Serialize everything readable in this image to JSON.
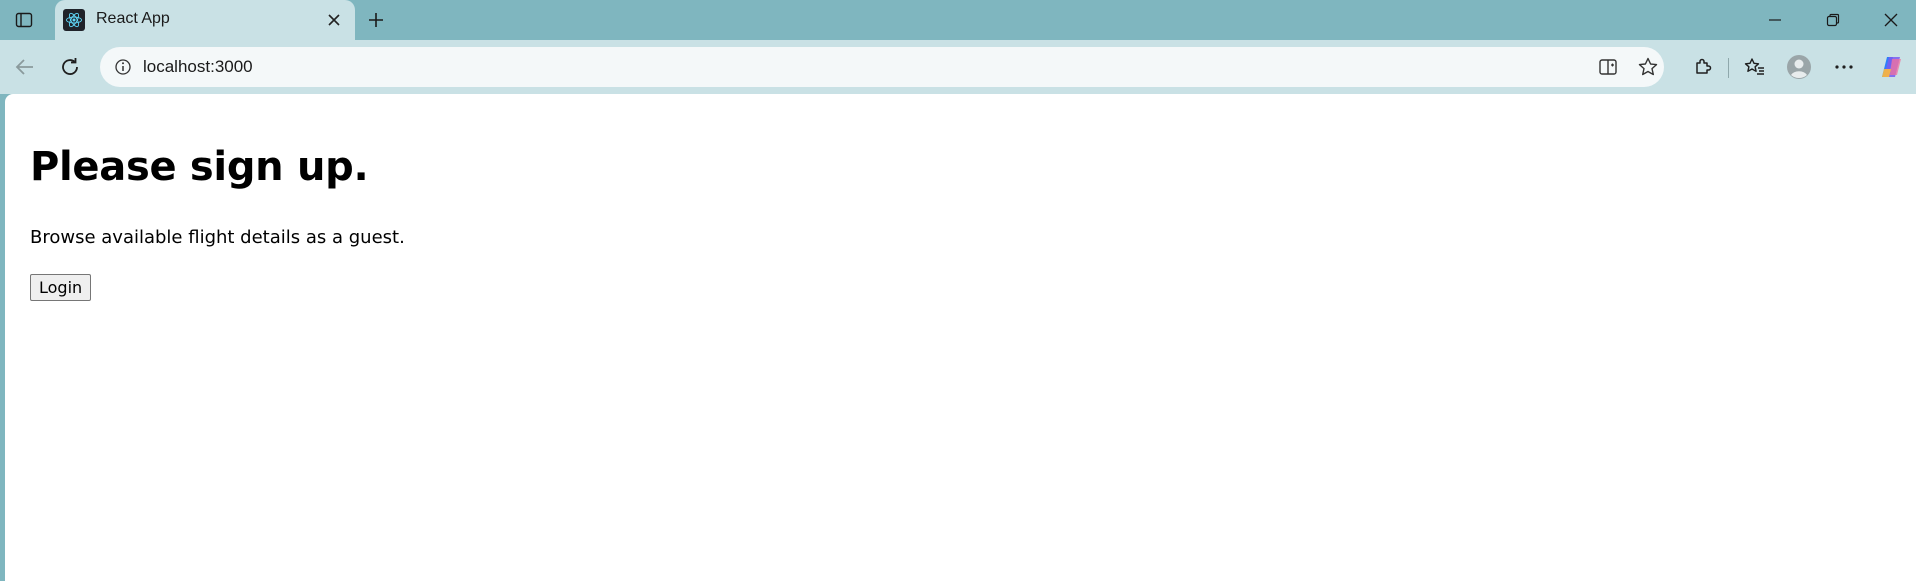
{
  "browser": {
    "tab": {
      "title": "React App",
      "favicon": "react-logo-icon"
    },
    "address_bar": {
      "url": "localhost:3000"
    },
    "colors": {
      "frame": "#7fb6bf",
      "toolbar": "#c9e1e5",
      "omnibox": "#f4f8f9"
    },
    "icons": [
      "tab-actions-icon",
      "close-icon",
      "new-tab-icon",
      "minimize-icon",
      "restore-icon",
      "window-close-icon",
      "back-icon",
      "reload-icon",
      "site-info-icon",
      "split-screen-icon",
      "favorite-star-icon",
      "extensions-icon",
      "favorites-icon",
      "profile-icon",
      "more-menu-icon",
      "copilot-icon"
    ]
  },
  "page": {
    "heading": "Please sign up.",
    "text": "Browse available flight details as a guest.",
    "login_button": "Login"
  }
}
